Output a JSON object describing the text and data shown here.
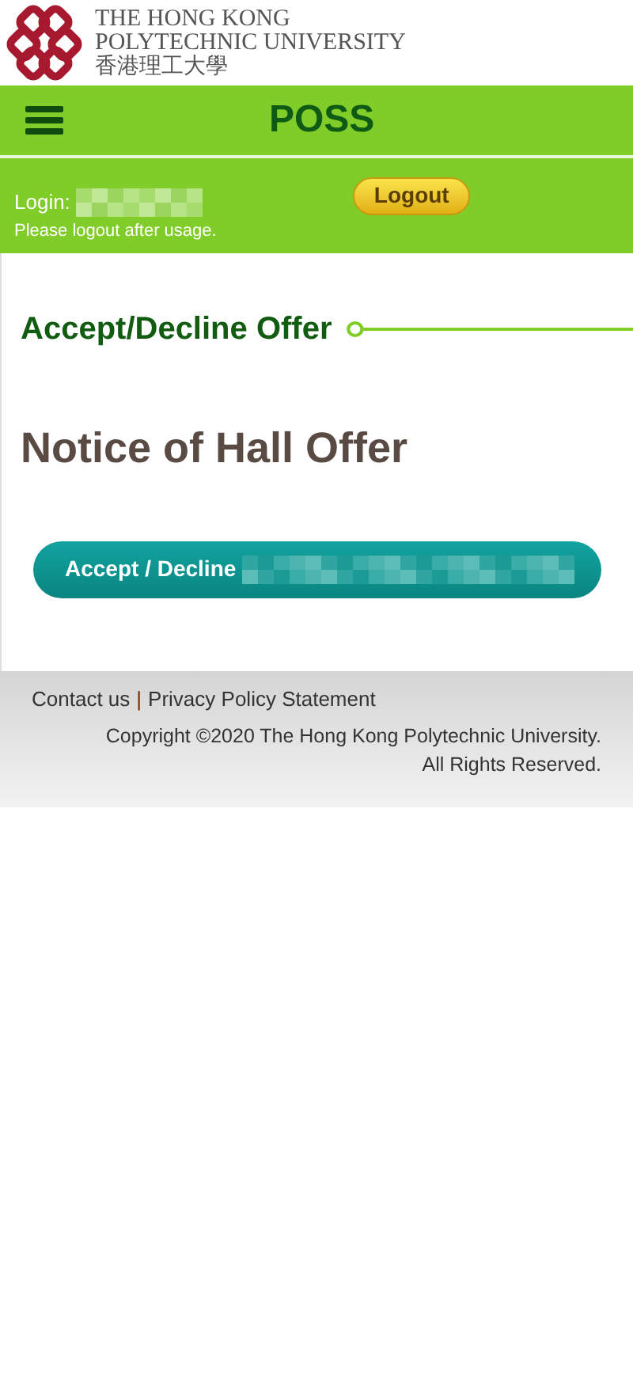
{
  "logo": {
    "lines": [
      "THE HONG KONG",
      "POLYTECHNIC UNIVERSITY",
      "香港理工大學"
    ]
  },
  "header": {
    "title": "POSS"
  },
  "login": {
    "label": "Login:",
    "button": "Logout",
    "note": "Please logout after usage."
  },
  "section": {
    "title": "Accept/Decline Offer"
  },
  "notice": {
    "title": "Notice of Hall Offer",
    "button": "Accept / Decline"
  },
  "footer": {
    "links": [
      "Contact us",
      "Privacy Policy Statement"
    ],
    "separator": "|",
    "copyright": "Copyright ©2020 The Hong Kong Polytechnic University.",
    "rights": "All Rights Reserved."
  }
}
